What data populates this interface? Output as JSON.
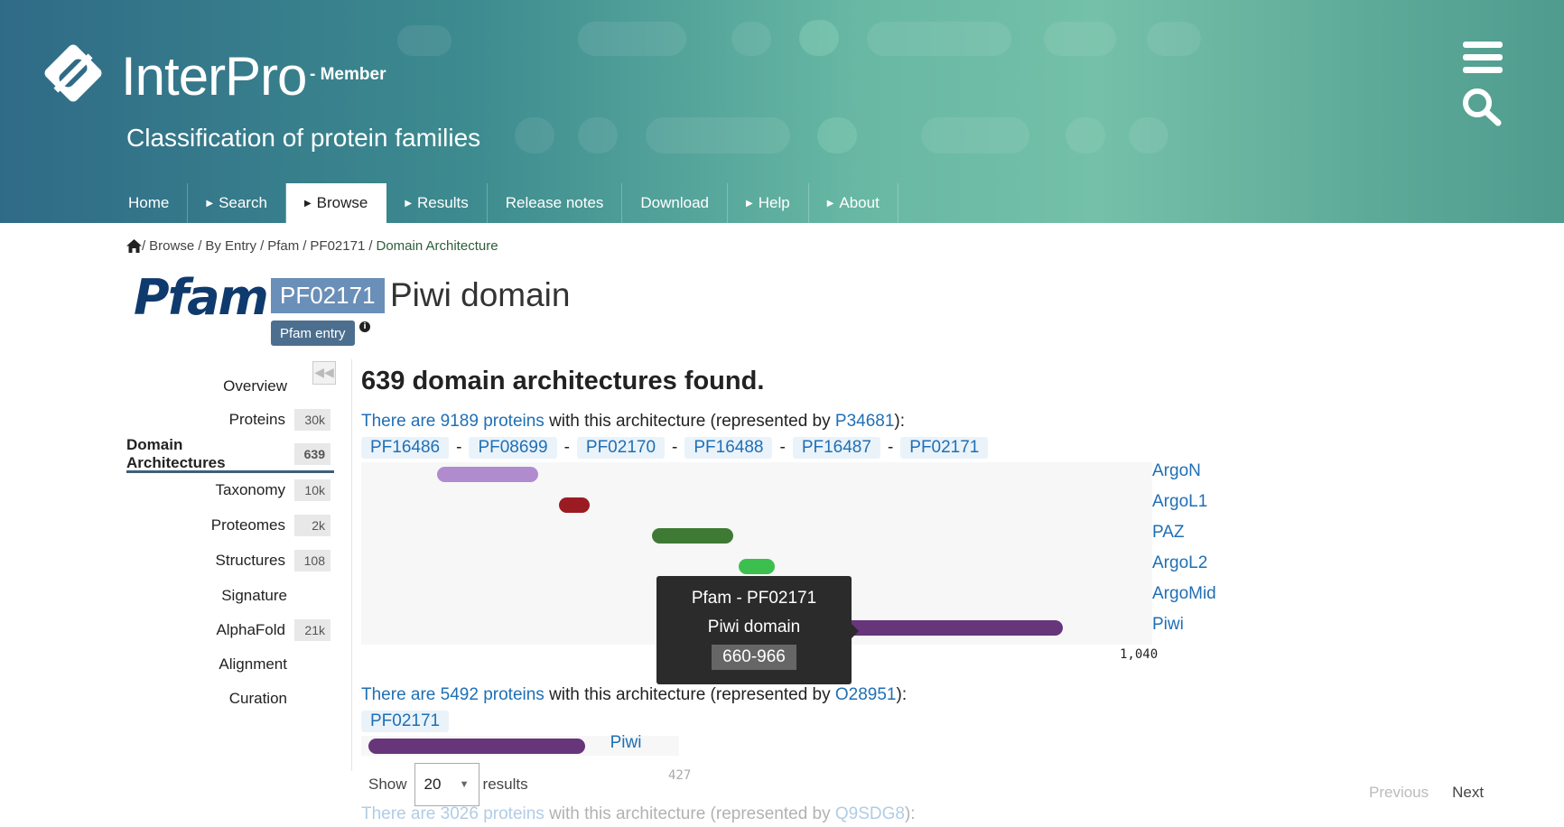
{
  "header": {
    "title": "InterPro",
    "subtitle": "- Member",
    "tagline": "Classification of protein families",
    "icons": [
      "logo-icon",
      "menu-icon",
      "search-icon"
    ]
  },
  "nav": {
    "items": [
      {
        "label": "Home",
        "arrow": false,
        "active": false
      },
      {
        "label": "Search",
        "arrow": true,
        "active": false
      },
      {
        "label": "Browse",
        "arrow": true,
        "active": true
      },
      {
        "label": "Results",
        "arrow": true,
        "active": false
      },
      {
        "label": "Release notes",
        "arrow": false,
        "active": false
      },
      {
        "label": "Download",
        "arrow": false,
        "active": false
      },
      {
        "label": "Help",
        "arrow": true,
        "active": false
      },
      {
        "label": "About",
        "arrow": true,
        "active": false
      }
    ]
  },
  "breadcrumb": {
    "items": [
      "Browse",
      "By Entry",
      "Pfam",
      "PF02171"
    ],
    "current": "Domain Architecture"
  },
  "entry": {
    "db_logo": "Pfam",
    "accession": "PF02171",
    "name": "Piwi domain",
    "type": "Pfam entry"
  },
  "sidebar": {
    "items": [
      {
        "label": "Overview",
        "count": null
      },
      {
        "label": "Proteins",
        "count": "30k"
      },
      {
        "label": "Domain Architectures",
        "count": "639",
        "active": true
      },
      {
        "label": "Taxonomy",
        "count": "10k"
      },
      {
        "label": "Proteomes",
        "count": "2k"
      },
      {
        "label": "Structures",
        "count": "108"
      },
      {
        "label": "Signature",
        "count": null
      },
      {
        "label": "AlphaFold",
        "count": "21k"
      },
      {
        "label": "Alignment",
        "count": null
      },
      {
        "label": "Curation",
        "count": null
      }
    ]
  },
  "main": {
    "heading": "639 domain architectures found.",
    "architectures": [
      {
        "link_text": "There are 9189 proteins",
        "middle_text": " with this architecture (represented by ",
        "rep": "P34681",
        "end_text": "):",
        "chips": [
          "PF16486",
          "PF08699",
          "PF02170",
          "PF16488",
          "PF16487",
          "PF02171"
        ],
        "length": 1040,
        "length_label": "1,040",
        "domains": [
          {
            "name": "ArgoN",
            "start": 105,
            "end": 244,
            "color": "#b08cce"
          },
          {
            "name": "ArgoL1",
            "start": 272,
            "end": 315,
            "color": "#9b1b22"
          },
          {
            "name": "PAZ",
            "start": 400,
            "end": 512,
            "color": "#3f7a35"
          },
          {
            "name": "ArgoL2",
            "start": 520,
            "end": 570,
            "color": "#3dbf4f"
          },
          {
            "name": "ArgoMid",
            "start": 578,
            "end": 650,
            "color": "#f7f7f7"
          },
          {
            "name": "Piwi",
            "start": 660,
            "end": 966,
            "color": "#66357a"
          }
        ]
      },
      {
        "link_text": "There are 5492 proteins",
        "middle_text": " with this architecture (represented by ",
        "rep": "O28951",
        "end_text": "):",
        "chips": [
          "PF02171"
        ],
        "length": 427,
        "length_label": "427",
        "domains": [
          {
            "name": "Piwi",
            "start": 10,
            "end": 311,
            "color": "#66357a"
          }
        ]
      },
      {
        "link_text": "There are 3026 proteins",
        "middle_text": " with this architecture (represented by ",
        "rep": "Q9SDG8",
        "end_text": "):"
      }
    ],
    "tooltip": {
      "line1": "Pfam - PF02171",
      "line2": "Piwi domain",
      "range": "660-966"
    },
    "show_label": "Show",
    "page_size": "20",
    "results_label": "results",
    "prev_label": "Previous",
    "next_label": "Next"
  }
}
